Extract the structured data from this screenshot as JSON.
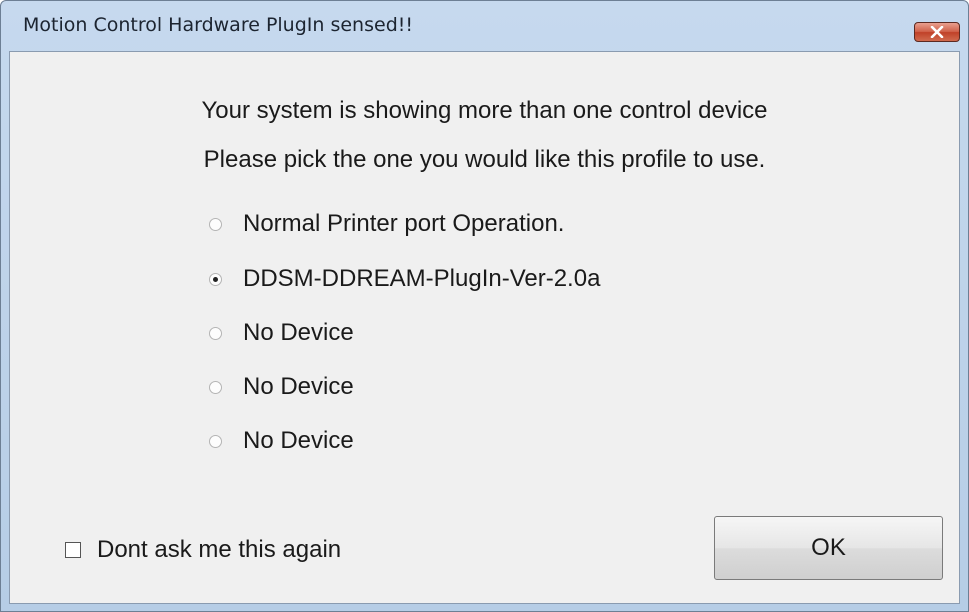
{
  "window": {
    "title": "Motion Control Hardware PlugIn sensed!!",
    "close_icon": "close-x-icon"
  },
  "message": {
    "line1": "Your system is showing more than one control device",
    "line2": "Please pick the one you would like this profile to use."
  },
  "devices": [
    {
      "label": "Normal Printer port Operation.",
      "checked": false
    },
    {
      "label": "DDSM-DDREAM-PlugIn-Ver-2.0a",
      "checked": true
    },
    {
      "label": "No Device",
      "checked": false
    },
    {
      "label": "No Device",
      "checked": false
    },
    {
      "label": "No Device",
      "checked": false
    }
  ],
  "dont_ask": {
    "label": "Dont ask me this again",
    "checked": false
  },
  "ok_button": {
    "label": "OK"
  },
  "colors": {
    "titlebar": "#c6d9ee",
    "close_button": "#c94a32",
    "client_bg": "#f0f0f0"
  }
}
